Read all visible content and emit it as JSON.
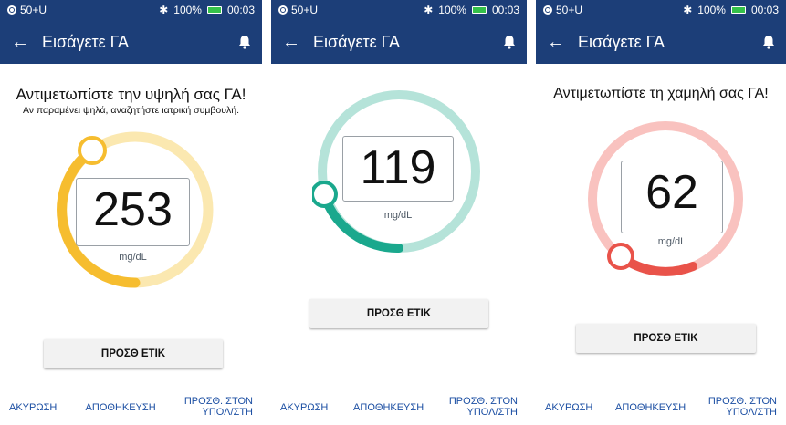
{
  "status_bar": {
    "left": "50+U",
    "battery": "100%",
    "time": "00:03",
    "battery_color": "#35c24a"
  },
  "header": {
    "title": "Εισάγετε ΓΑ",
    "bg_color": "#1c3e78"
  },
  "common": {
    "tag_button": "ΠΡΟΣΘ ΕΤΙΚ",
    "cancel": "ΑΚΥΡΩΣΗ",
    "save": "ΑΠΟΘΗΚΕΥΣΗ",
    "add_line1": "ΠΡΟΣΘ. ΣΤΟΝ",
    "add_line2": "ΥΠΟΛ/ΣΤΗ",
    "unit": "mg/dL"
  },
  "screens": [
    {
      "message": "Αντιμετωπίστε την υψηλή σας ΓΑ!",
      "submessage": "Αν παραμένει ψηλά, αναζητήστε ιατρική συμβουλή.",
      "value": "253",
      "gauge_color": "#f6bd2f",
      "track_color": "#fbe8b0"
    },
    {
      "message": "",
      "submessage": "",
      "value": "119",
      "gauge_color": "#1aa88d",
      "track_color": "#b5e3d9"
    },
    {
      "message": "Αντιμετωπίστε τη χαμηλή σας ΓΑ!",
      "submessage": "",
      "value": "62",
      "gauge_color": "#e9534a",
      "track_color": "#f9c2bf"
    }
  ]
}
